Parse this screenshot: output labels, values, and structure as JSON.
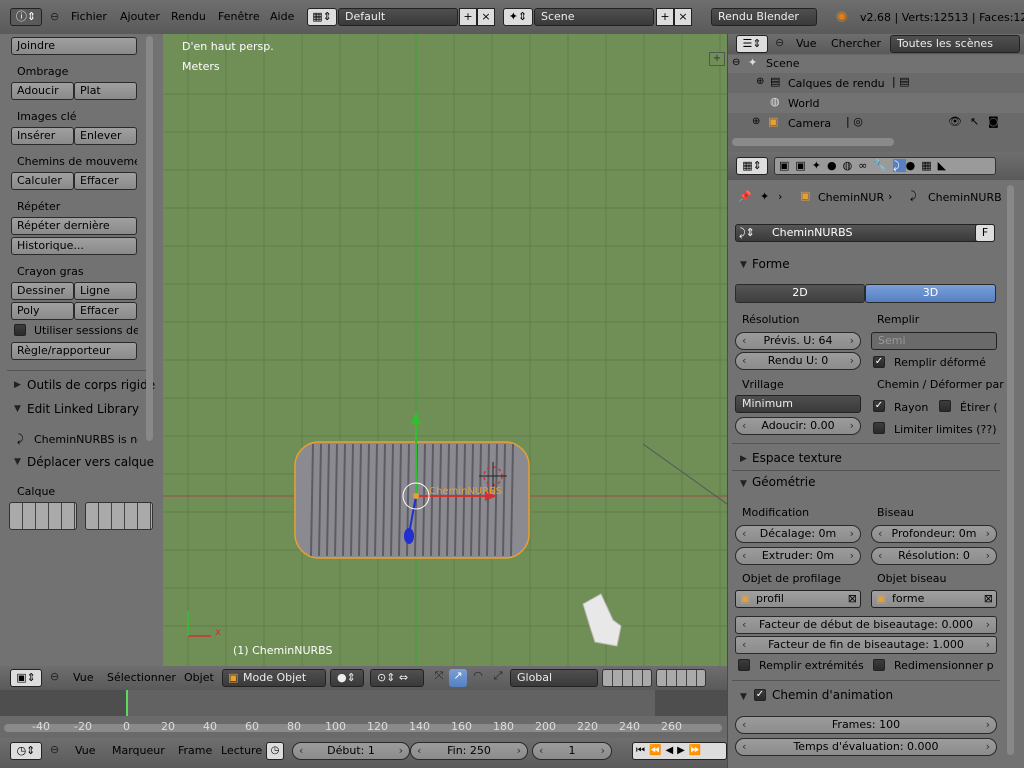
{
  "topbar": {
    "menus": [
      "Fichier",
      "Ajouter",
      "Rendu",
      "Fenêtre",
      "Aide"
    ],
    "layout": "Default",
    "scene": "Scene",
    "engine": "Rendu Blender",
    "stats": "v2.68 | Verts:12513 | Faces:12"
  },
  "toolshelf": {
    "joindre": "Joindre",
    "ombrage_label": "Ombrage",
    "adoucir": "Adoucir",
    "plat": "Plat",
    "images_cle_label": "Images clé",
    "inserer": "Insérer",
    "enlever": "Enlever",
    "chemins_label": "Chemins de mouvemen",
    "calculer": "Calculer",
    "effacer": "Effacer",
    "repeter_label": "Répéter",
    "repeter_derniere": "Répéter dernière",
    "historique": "Historique...",
    "crayon_label": "Crayon gras",
    "dessiner": "Dessiner",
    "ligne": "Ligne",
    "poly": "Poly",
    "effacer2": "Effacer",
    "utiliser_sessions": "Utiliser sessions de",
    "regle": "Règle/rapporteur",
    "outils_corps": "Outils de corps rigide",
    "edit_linked": "Edit Linked Library",
    "linked_obj": "CheminNURBS is no",
    "deplacer": "Déplacer vers calque",
    "calque_label": "Calque"
  },
  "viewport": {
    "view_name": "D'en haut persp.",
    "units": "Meters",
    "object_label": "(1) CheminNURBS",
    "obj_text": "CheminNURBS",
    "axis_x": "x",
    "grid_color": "#6f8f57"
  },
  "viewport_header": {
    "vue": "Vue",
    "selectionner": "Sélectionner",
    "objet": "Objet",
    "mode": "Mode Objet",
    "orientation": "Global"
  },
  "timeline": {
    "ruler": [
      "-40",
      "-20",
      "0",
      "20",
      "40",
      "60",
      "80",
      "100",
      "120",
      "140",
      "160",
      "180",
      "200",
      "220",
      "240",
      "260"
    ],
    "current_frame_label": "0",
    "vue": "Vue",
    "marqueur": "Marqueur",
    "frame": "Frame",
    "lecture": "Lecture",
    "debut": "Début: 1",
    "fin": "Fin: 250",
    "current": "1"
  },
  "outliner": {
    "vue": "Vue",
    "chercher": "Chercher",
    "filter": "Toutes les scènes",
    "items": [
      "Scene",
      "Calques de rendu",
      "World",
      "Camera"
    ]
  },
  "properties": {
    "breadcrumb1": "CheminNUR",
    "breadcrumb2": "CheminNURB",
    "datablock": "CheminNURBS",
    "fake_user": "F",
    "forme": "Forme",
    "tab_2d": "2D",
    "tab_3d": "3D",
    "resolution_label": "Résolution",
    "previs": "Prévis. U: 64",
    "rendu": "Rendu U: 0",
    "remplir_label": "Remplir",
    "remplir_value": "Semi",
    "remplir_deforme": "Remplir déformé",
    "vrillage_label": "Vrillage",
    "vrillage_value": "Minimum",
    "adoucir": "Adoucir: 0.00",
    "chemin_deformer": "Chemin / Déformer par",
    "rayon": "Rayon",
    "etirer": "Étirer (",
    "limiter": "Limiter limites (??)",
    "espace_texture": "Espace texture",
    "geometrie": "Géométrie",
    "modification": "Modification",
    "biseau": "Biseau",
    "decalage": "Décalage: 0m",
    "profondeur": "Profondeur: 0m",
    "extruder": "Extruder: 0m",
    "resolution": "Résolution: 0",
    "objet_profil_label": "Objet de profilage",
    "objet_biseau_label": "Objet biseau",
    "profil": "profil",
    "forme_obj": "forme",
    "facteur_debut": "Facteur de début de biseautage: 0.000",
    "facteur_fin": "Facteur de fin de biseautage: 1.000",
    "remplir_extremites": "Remplir extrémités",
    "redimensionner": "Redimensionner pro",
    "chemin_animation": "Chemin d'animation",
    "frames": "Frames: 100",
    "temps": "Temps d'évaluation: 0.000"
  }
}
